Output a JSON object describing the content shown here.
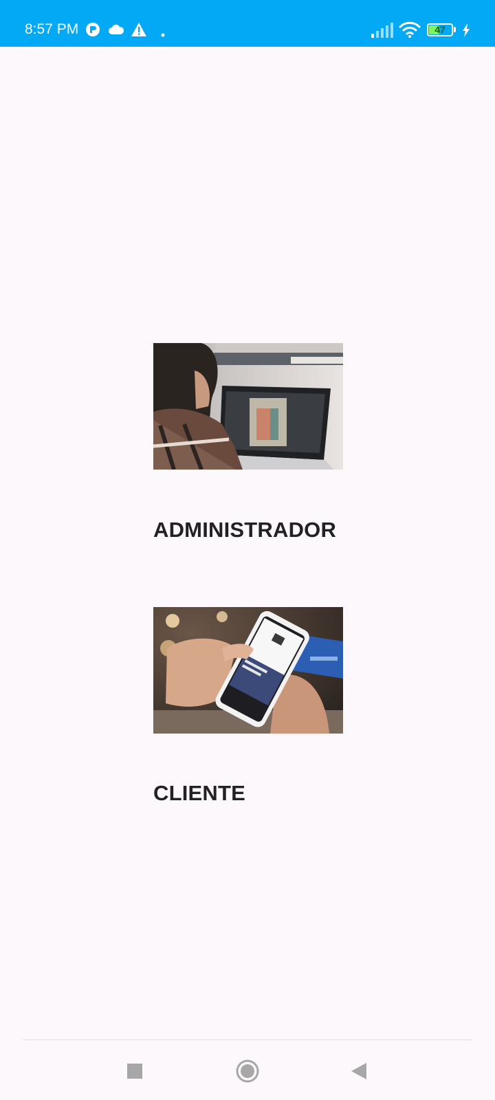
{
  "status_bar": {
    "time": "8:57 PM",
    "battery_level": "47",
    "battery_fraction": 0.47,
    "background_color": "#03a9f4",
    "icons": [
      "app-notification-icon",
      "cloud-icon",
      "warning-icon",
      "dot-icon",
      "signal-icon",
      "wifi-icon",
      "battery-icon",
      "charging-icon"
    ]
  },
  "roles": [
    {
      "label": "ADMINISTRADOR",
      "image": "photo of a woman working on a laptop with photo editing software"
    },
    {
      "label": "CLIENTE",
      "image": "photo of hands holding a smartphone with a shopping app and a credit card"
    }
  ],
  "navigation_bar": {
    "buttons": [
      "recents-button",
      "home-button",
      "back-button"
    ]
  }
}
